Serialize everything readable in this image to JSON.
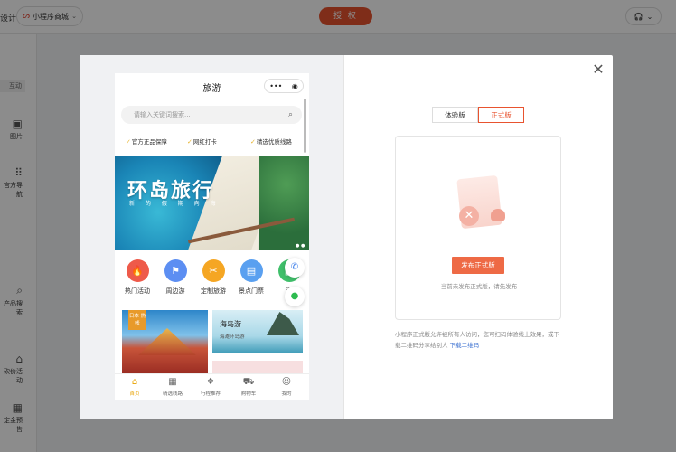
{
  "topbar": {
    "left_cut": "设计",
    "app_name": "小程序商城",
    "auth_button": "授 权"
  },
  "leftnav": {
    "top_item": "互动",
    "items": [
      {
        "label": "图片",
        "icon": "image-icon"
      },
      {
        "label": "官方导航",
        "icon": "grid-dots-icon"
      },
      {
        "label": "产品搜索",
        "icon": "search-grid-icon"
      },
      {
        "label": "砍价活动",
        "icon": "tag-icon"
      },
      {
        "label": "定金预售",
        "icon": "calendar-icon"
      }
    ]
  },
  "phone": {
    "title": "旅游",
    "capsule_more": "•••",
    "capsule_target": "◉",
    "search_placeholder": "请输入关键词搜索...",
    "features": [
      "官方正品保障",
      "网红打卡",
      "精选优质线路"
    ],
    "banner": {
      "title": "环岛旅行",
      "subtitle": "新 的 假 期 向 海"
    },
    "categories": [
      {
        "label": "热门活动",
        "color": "#ee5a4a",
        "glyph": "🔥"
      },
      {
        "label": "周边游",
        "color": "#5c8ef2",
        "glyph": "⚑"
      },
      {
        "label": "定制旅游",
        "color": "#f5a623",
        "glyph": "✂"
      },
      {
        "label": "景点门票",
        "color": "#5aa0f0",
        "glyph": "▤"
      },
      {
        "label": "酒",
        "color": "#3fbf6a",
        "glyph": "▦"
      }
    ],
    "card1_tag": "日本 热帐",
    "card2_title": "海岛游",
    "card2_sub": "海滩环岛游",
    "tabs": [
      {
        "label": "首页",
        "icon": "home-icon",
        "glyph": "⌂"
      },
      {
        "label": "精选线路",
        "icon": "grid-icon",
        "glyph": "▦"
      },
      {
        "label": "行程推荐",
        "icon": "gift-icon",
        "glyph": "❖"
      },
      {
        "label": "购物车",
        "icon": "cart-icon",
        "glyph": "⛟"
      },
      {
        "label": "我的",
        "icon": "user-icon",
        "glyph": "☺"
      }
    ]
  },
  "panel": {
    "tab_trial": "体验版",
    "tab_official": "正式版",
    "publish_button": "发布正式版",
    "publish_hint": "当前未发布正式版，请先发布",
    "note_text": "小程序正式版允许被所有人访问，您可扫码体验线上效果，或下载二维码分享给别人",
    "note_link": "下载二维码"
  }
}
